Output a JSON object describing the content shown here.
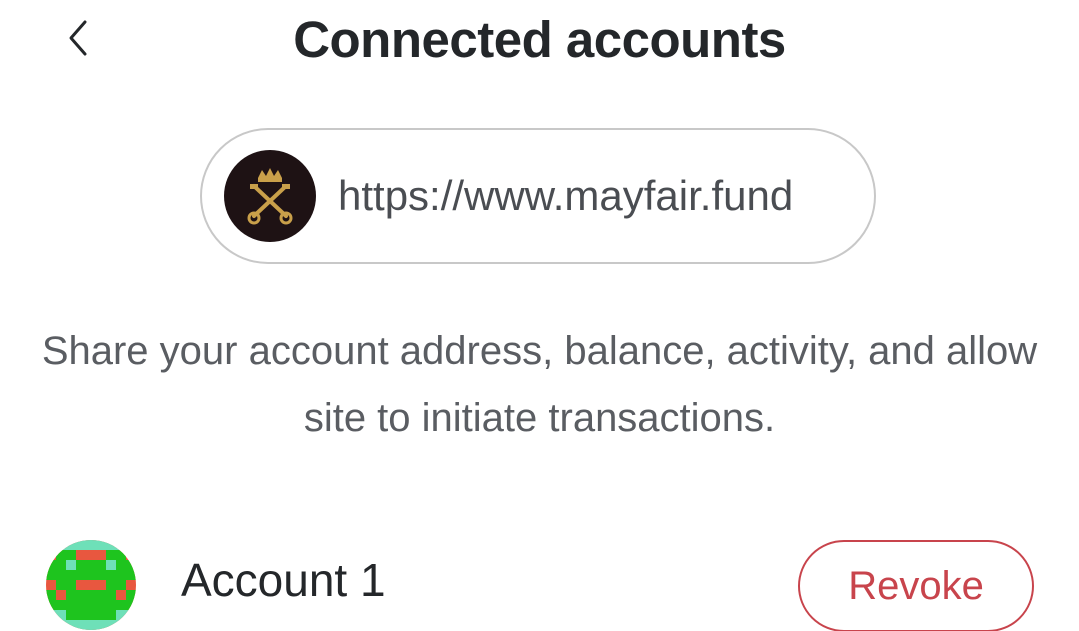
{
  "header": {
    "title": "Connected accounts",
    "back_icon": "chevron-left-icon"
  },
  "site": {
    "url": "https://www.mayfair.fund",
    "logo_icon": "crossed-keys-crown-logo"
  },
  "description": "Share your account address, balance, activity, and allow site to initiate transactions.",
  "accounts": [
    {
      "name": "Account 1",
      "avatar_icon": "identicon-avatar",
      "action_label": "Revoke"
    }
  ],
  "colors": {
    "title": "#24272a",
    "danger": "#c8444c",
    "pill_border": "#c8c8c8",
    "logo_bg": "#1e1214",
    "logo_gold": "#c9a04a"
  }
}
